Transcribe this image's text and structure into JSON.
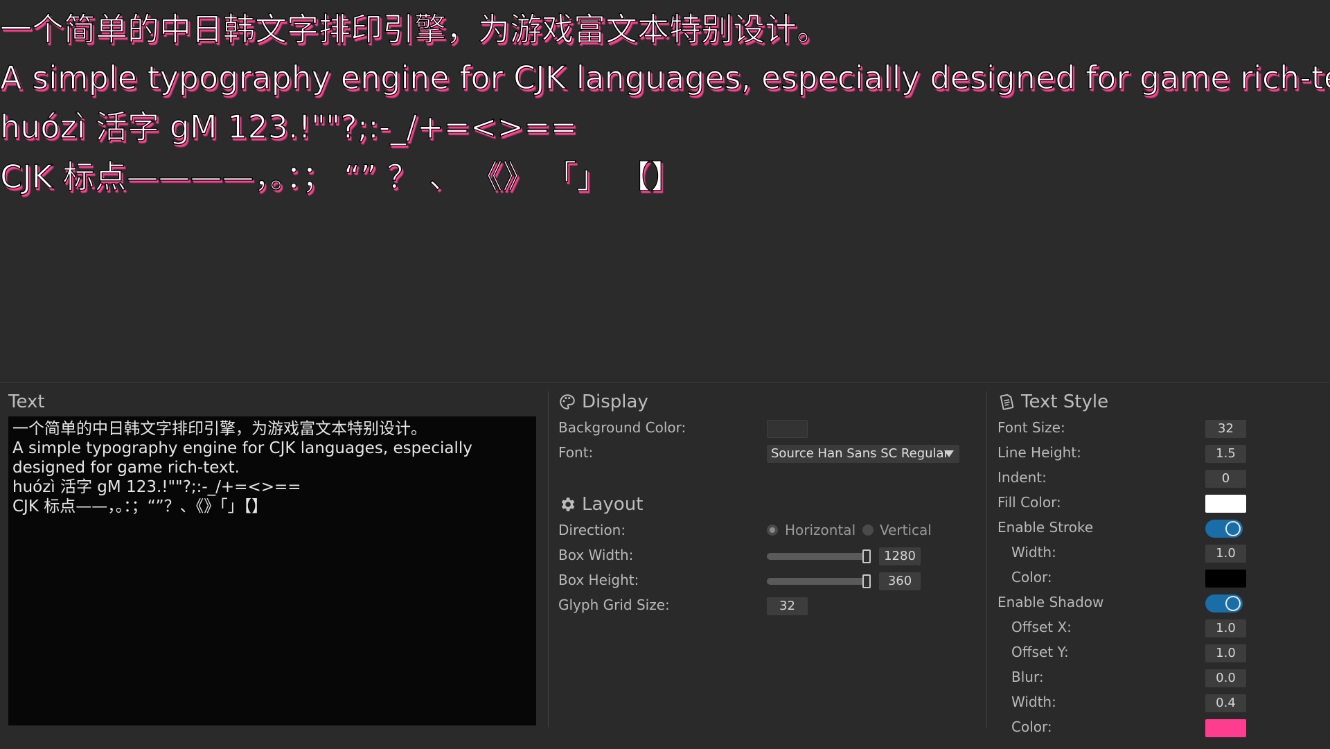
{
  "preview": {
    "lines": [
      "一个简单的中日韩文字排印引擎，为游戏富文本特别设计。",
      "A simple typography engine for CJK languages, especially designed for game rich-text.",
      "huózì 活字 gM 123.!\"\"?;:-_/+=<>==",
      "CJK 标点————，。：；  “”  ？ 、  《》 「」 【】"
    ]
  },
  "text_section": {
    "title": "Text",
    "content": "一个简单的中日韩文字排印引擎，为游戏富文本特别设计。\nA simple typography engine for CJK languages, especially designed for game rich-text.\nhuózì 活字 gM 123.!\"\"?;:-_/+=<>==\nCJK 标点——，。：；“”？、《》「」【】"
  },
  "display": {
    "title": "Display",
    "background_color_label": "Background Color:",
    "background_color": "#2b2b2b",
    "font_label": "Font:",
    "font_value": "Source Han Sans SC Regular"
  },
  "layout": {
    "title": "Layout",
    "direction_label": "Direction:",
    "direction_options": [
      "Horizontal",
      "Vertical"
    ],
    "direction_selected": "Horizontal",
    "box_width_label": "Box Width:",
    "box_width_value": "1280",
    "box_width_fraction": 1.0,
    "box_height_label": "Box Height:",
    "box_height_value": "360",
    "box_height_fraction": 1.0,
    "glyph_grid_label": "Glyph Grid Size:",
    "glyph_grid_value": "32"
  },
  "text_style": {
    "title": "Text Style",
    "font_size_label": "Font Size:",
    "font_size": "32",
    "line_height_label": "Line Height:",
    "line_height": "1.5",
    "indent_label": "Indent:",
    "indent": "0",
    "fill_color_label": "Fill Color:",
    "fill_color": "#ffffff",
    "enable_stroke_label": "Enable Stroke",
    "enable_stroke": true,
    "stroke_width_label": "Width:",
    "stroke_width": "1.0",
    "stroke_color_label": "Color:",
    "stroke_color": "#000000",
    "enable_shadow_label": "Enable Shadow",
    "enable_shadow": true,
    "offset_x_label": "Offset X:",
    "offset_x": "1.0",
    "offset_y_label": "Offset Y:",
    "offset_y": "1.0",
    "blur_label": "Blur:",
    "blur": "0.0",
    "shadow_width_label": "Width:",
    "shadow_width": "0.4",
    "shadow_color_label": "Color:",
    "shadow_color": "#ff3d8e"
  },
  "icons": {
    "display": "palette-icon",
    "layout": "gear-icon",
    "text_style": "document-icon"
  },
  "colors": {
    "accent": "#1a6ea8",
    "shadow_pink": "#ff3d8e"
  }
}
